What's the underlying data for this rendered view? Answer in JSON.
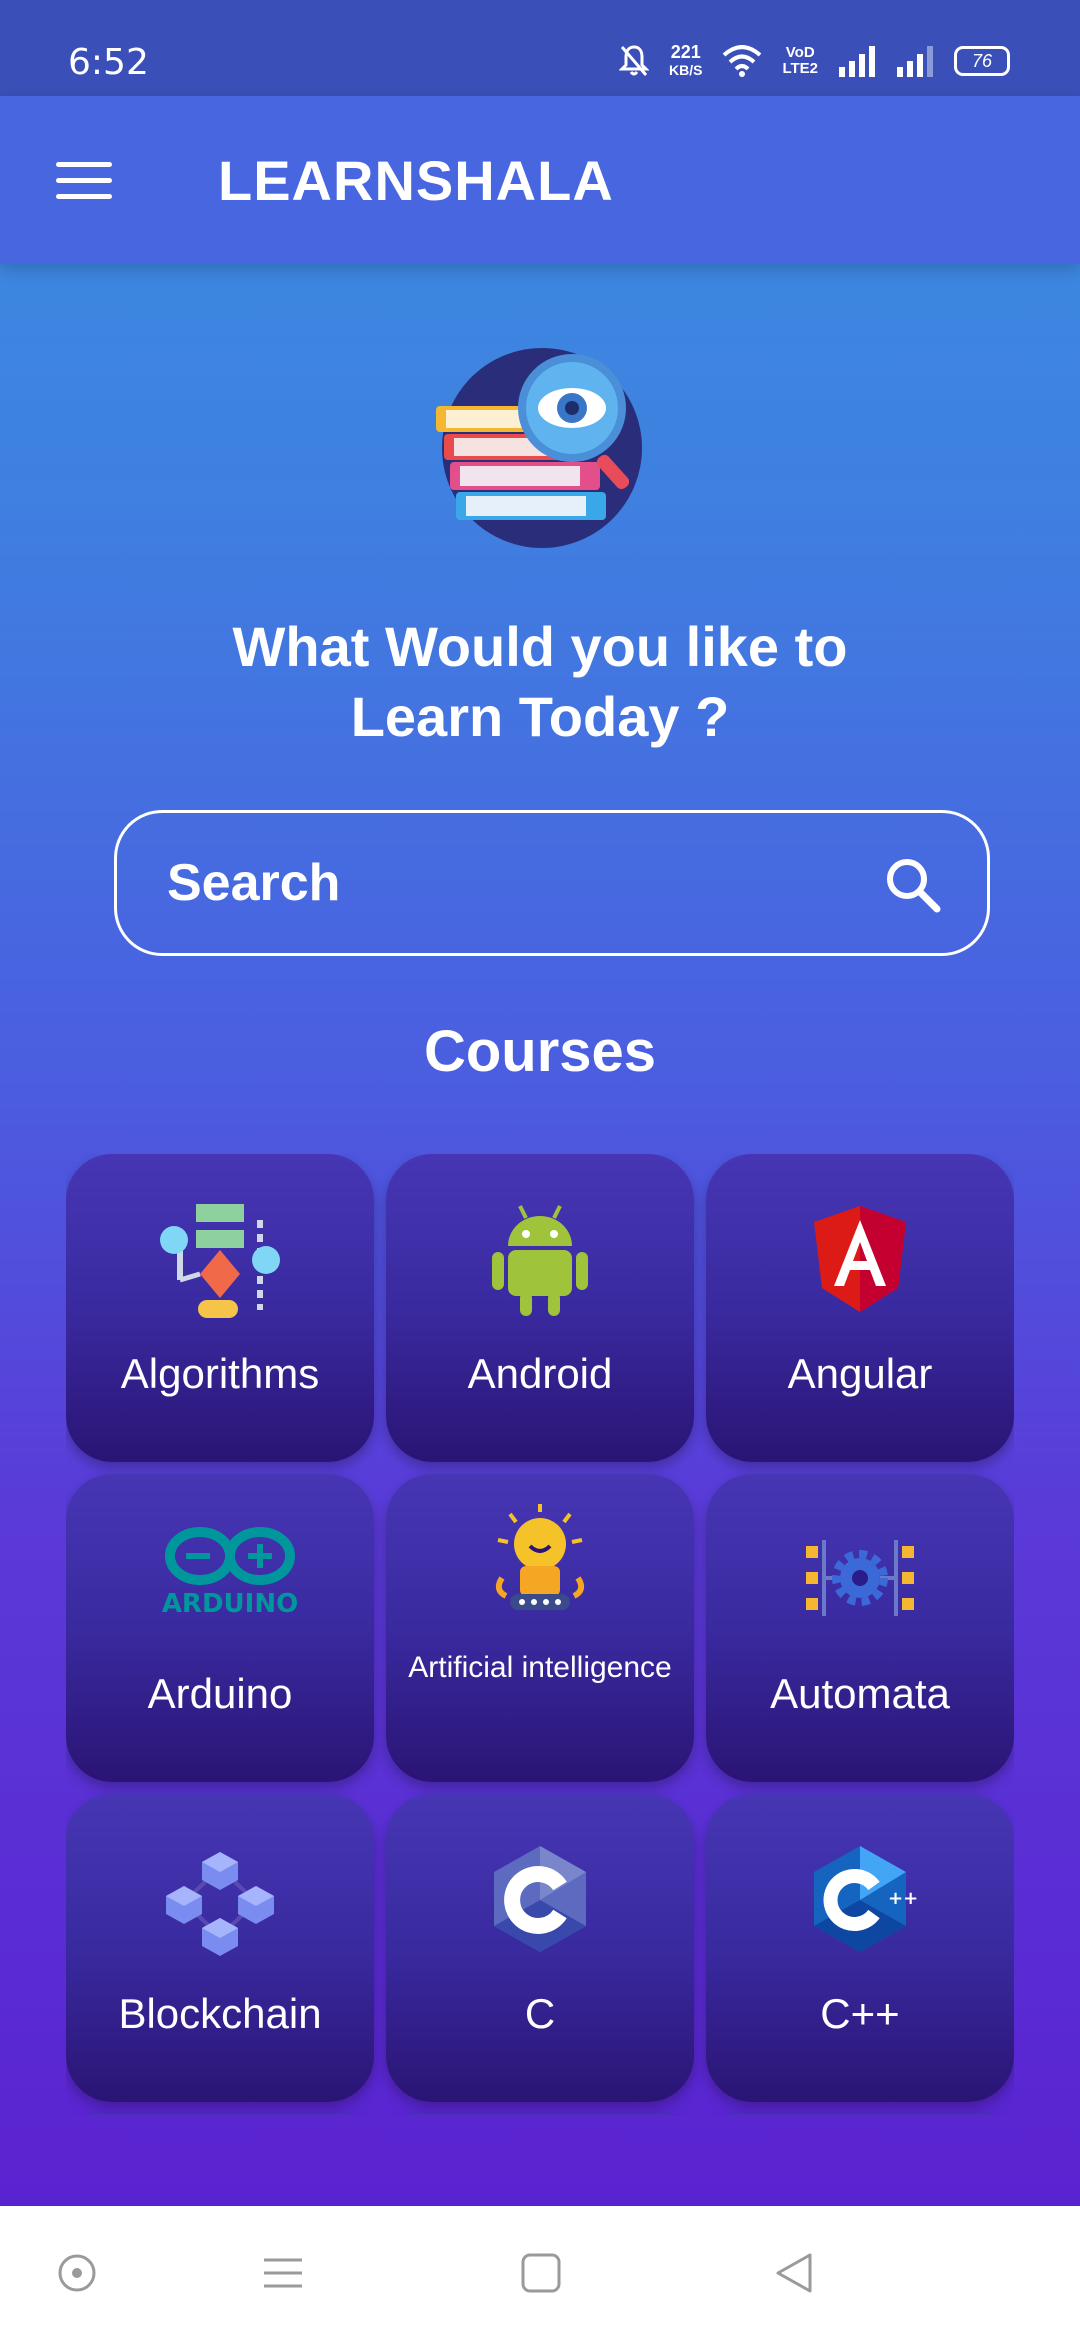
{
  "status_bar": {
    "time": "6:52",
    "speed_value": "221",
    "speed_unit": "KB/S",
    "volte_top": "VoD",
    "volte_bottom": "LTE2",
    "battery": "76"
  },
  "app_bar": {
    "title": "LEARNSHALA"
  },
  "hero": {
    "headline_line1": "What Would you like to",
    "headline_line2": "Learn Today ?"
  },
  "search": {
    "placeholder": "Search"
  },
  "courses": {
    "title": "Courses",
    "items": [
      {
        "label": "Algorithms",
        "icon": "algorithm-flowchart-icon"
      },
      {
        "label": "Android",
        "icon": "android-icon"
      },
      {
        "label": "Angular",
        "icon": "angular-icon"
      },
      {
        "label": "Arduino",
        "icon": "arduino-icon"
      },
      {
        "label": "Artificial intelligence",
        "icon": "ai-robot-icon"
      },
      {
        "label": "Automata",
        "icon": "automata-gear-icon"
      },
      {
        "label": "Blockchain",
        "icon": "blockchain-cubes-icon"
      },
      {
        "label": "C",
        "icon": "c-language-icon"
      },
      {
        "label": "C++",
        "icon": "cpp-language-icon"
      }
    ]
  },
  "colors": {
    "app_bar": "#4766df",
    "status_bar": "#3b4fb8",
    "card_top": "#4636b4",
    "card_bottom": "#2a1474"
  }
}
